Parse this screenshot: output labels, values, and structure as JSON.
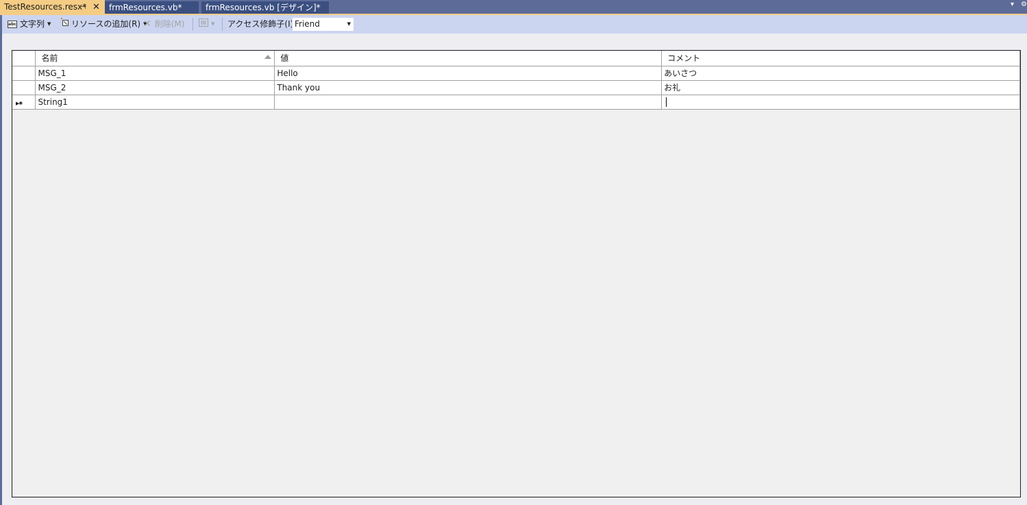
{
  "tabs": [
    {
      "label": "TestResources.resx*",
      "active": true
    },
    {
      "label": "frmResources.vb*",
      "active": false
    },
    {
      "label": "frmResources.vb [デザイン]*",
      "active": false
    }
  ],
  "toolbar": {
    "strings_label": "文字列",
    "add_resource_label": "リソースの追加(R)",
    "delete_label": "削除(M)",
    "access_modifier_label": "アクセス修飾子(I):",
    "access_modifier_value": "Friend"
  },
  "grid": {
    "columns": [
      "名前",
      "値",
      "コメント"
    ],
    "rows": [
      {
        "name": "MSG_1",
        "value": "Hello",
        "comment": "あいさつ"
      },
      {
        "name": "MSG_2",
        "value": "Thank you",
        "comment": "お礼"
      },
      {
        "name": "String1",
        "value": "",
        "comment": ""
      }
    ]
  },
  "colors": {
    "tab_strip": "#5d6b99",
    "active_tab": "#f5cc84",
    "inactive_tab": "#3b4f81",
    "toolbar": "#ccd5f0"
  },
  "icons": [
    "pin-icon",
    "close-icon",
    "string-type-icon",
    "add-resource-icon",
    "delete-icon",
    "view-icon",
    "dropdown-caret-icon",
    "sort-ascending-icon",
    "new-row-indicator-icon"
  ]
}
